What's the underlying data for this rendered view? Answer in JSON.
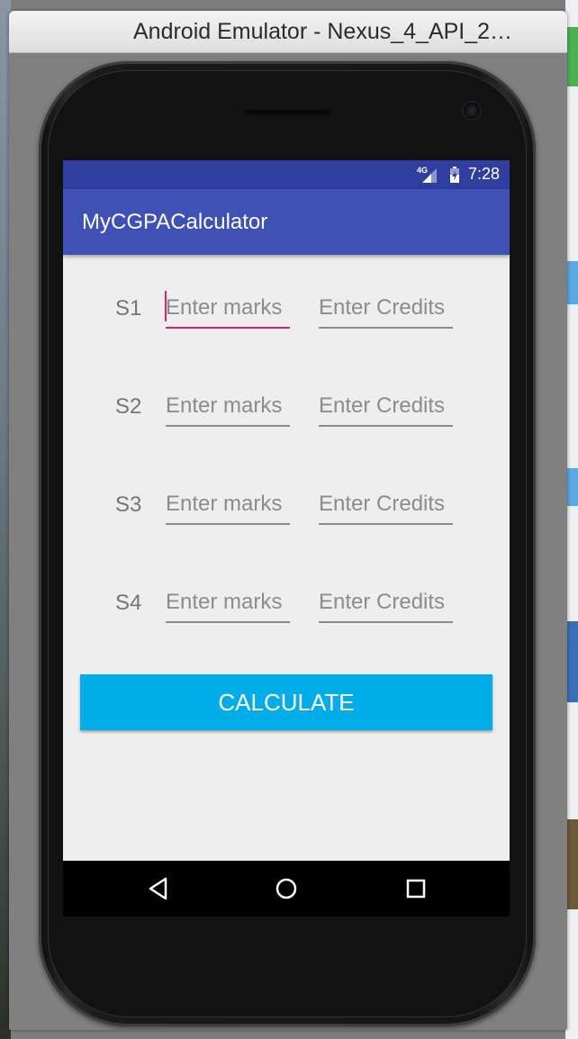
{
  "window": {
    "title": "Android Emulator - Nexus_4_API_2…"
  },
  "status_bar": {
    "network_type": "4G",
    "time": "7:28"
  },
  "app_bar": {
    "title": "MyCGPACalculator"
  },
  "semesters": [
    {
      "label": "S1",
      "marks_placeholder": "Enter marks",
      "credits_placeholder": "Enter Credits",
      "marks_value": "",
      "credits_value": ""
    },
    {
      "label": "S2",
      "marks_placeholder": "Enter marks",
      "credits_placeholder": "Enter Credits",
      "marks_value": "",
      "credits_value": ""
    },
    {
      "label": "S3",
      "marks_placeholder": "Enter marks",
      "credits_placeholder": "Enter Credits",
      "marks_value": "",
      "credits_value": ""
    },
    {
      "label": "S4",
      "marks_placeholder": "Enter marks",
      "credits_placeholder": "Enter Credits",
      "marks_value": "",
      "credits_value": ""
    }
  ],
  "calculate_button": {
    "label": "CALCULATE"
  },
  "colors": {
    "status_bar": "#303f9f",
    "app_bar": "#3f51b5",
    "accent": "#e91e63",
    "button": "#00ade8",
    "screen_bg": "#eeeeee"
  },
  "navigation": {
    "back_icon": "back-triangle-icon",
    "home_icon": "home-circle-icon",
    "recents_icon": "recents-square-icon"
  }
}
